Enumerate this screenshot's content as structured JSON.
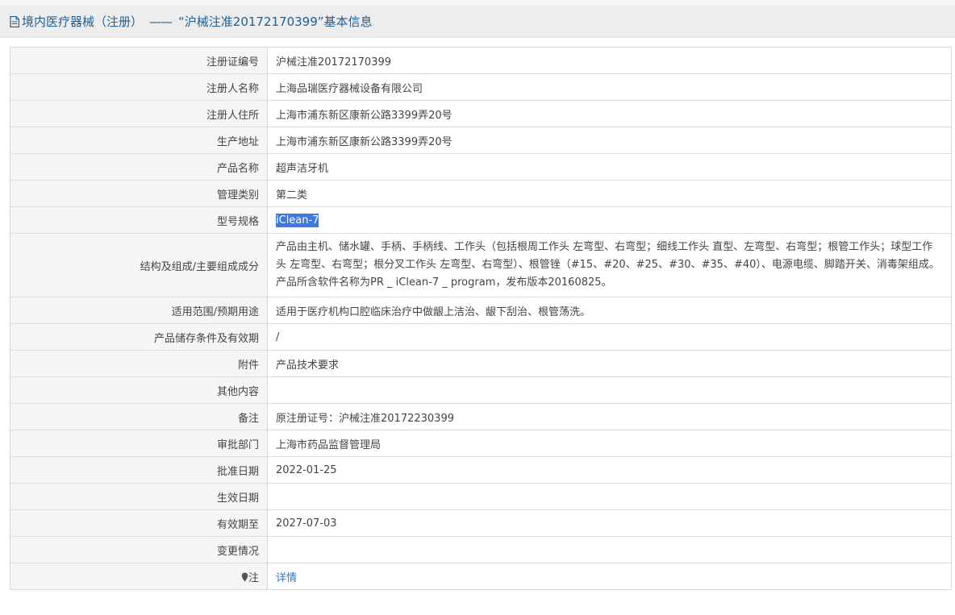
{
  "header": {
    "category": "境内医疗器械（注册）",
    "dash": "——",
    "title": "“沪械注准20172170399”基本信息"
  },
  "rows": [
    {
      "label": "注册证编号",
      "value": "沪械注准20172170399"
    },
    {
      "label": "注册人名称",
      "value": "上海品瑞医疗器械设备有限公司"
    },
    {
      "label": "注册人住所",
      "value": "上海市浦东新区康新公路3399弄20号"
    },
    {
      "label": "生产地址",
      "value": "上海市浦东新区康新公路3399弄20号"
    },
    {
      "label": "产品名称",
      "value": "超声洁牙机"
    },
    {
      "label": "管理类别",
      "value": "第二类"
    },
    {
      "label": "型号规格",
      "value": "iClean-7"
    },
    {
      "label": "结构及组成/主要组成成分",
      "value": "产品由主机、储水罐、手柄、手柄线、工作头（包括根周工作头 左弯型、右弯型；细线工作头 直型、左弯型、右弯型；根管工作头；球型工作头 左弯型、右弯型；根分叉工作头 左弯型、右弯型）、根管锉（#15、#20、#25、#30、#35、#40）、电源电缆、脚踏开关、消毒架组成。产品所含软件名称为PR _ iClean-7 _ program，发布版本20160825。"
    },
    {
      "label": "适用范围/预期用途",
      "value": "适用于医疗机构口腔临床治疗中做龈上洁治、龈下刮治、根管荡洗。"
    },
    {
      "label": "产品储存条件及有效期",
      "value": "/"
    },
    {
      "label": "附件",
      "value": "产品技术要求"
    },
    {
      "label": "其他内容",
      "value": ""
    },
    {
      "label": "备注",
      "value": "原注册证号：沪械注准20172230399"
    },
    {
      "label": "审批部门",
      "value": "上海市药品监督管理局"
    },
    {
      "label": "批准日期",
      "value": "2022-01-25"
    },
    {
      "label": "生效日期",
      "value": ""
    },
    {
      "label": "有效期至",
      "value": "2027-07-03"
    },
    {
      "label": "变更情况",
      "value": ""
    },
    {
      "label": "注",
      "value": "详情"
    }
  ]
}
